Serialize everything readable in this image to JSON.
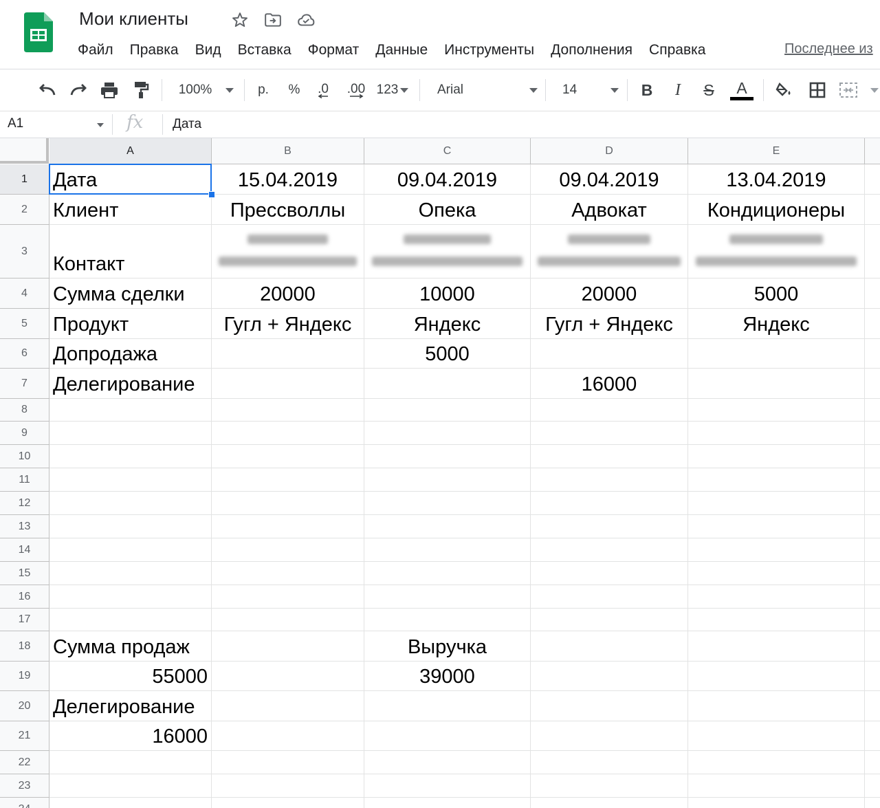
{
  "document": {
    "title": "Мои клиенты"
  },
  "menu": [
    "Файл",
    "Правка",
    "Вид",
    "Вставка",
    "Формат",
    "Данные",
    "Инструменты",
    "Дополнения",
    "Справка"
  ],
  "last_edit_label": "Последнее из",
  "toolbar": {
    "zoom": "100%",
    "currency": "р.",
    "percent": "%",
    "decrease_decimals": ".0",
    "increase_decimals": ".00",
    "number_format": "123",
    "font": "Arial",
    "font_size": "14",
    "bold": "B",
    "italic": "I",
    "strikethrough": "S",
    "text_color": "A"
  },
  "formula_bar": {
    "cell_ref": "A1",
    "fx_label": "fx",
    "content": "Дата"
  },
  "columns": [
    "A",
    "B",
    "C",
    "D",
    "E"
  ],
  "row_numbers": [
    "1",
    "2",
    "3",
    "4",
    "5",
    "6",
    "7",
    "8",
    "9",
    "10",
    "11",
    "12",
    "13",
    "14",
    "15",
    "16",
    "17",
    "18",
    "19",
    "20",
    "21",
    "22",
    "23",
    "24"
  ],
  "rows": [
    [
      "Дата",
      "15.04.2019",
      "09.04.2019",
      "09.04.2019",
      "13.04.2019"
    ],
    [
      "Клиент",
      "Прессволлы",
      "Опека",
      "Адвокат",
      "Кондиционеры"
    ],
    [
      "Контакт",
      "",
      "",
      "",
      ""
    ],
    [
      "Сумма сделки",
      "20000",
      "10000",
      "20000",
      "5000"
    ],
    [
      "Продукт",
      "Гугл + Яндекс",
      "Яндекс",
      "Гугл + Яндекс",
      "Яндекс"
    ],
    [
      "Допродажа",
      "",
      "5000",
      "",
      ""
    ],
    [
      "Делегирование",
      "",
      "",
      "16000",
      ""
    ],
    [
      "",
      "",
      "",
      "",
      ""
    ],
    [
      "",
      "",
      "",
      "",
      ""
    ],
    [
      "",
      "",
      "",
      "",
      ""
    ],
    [
      "",
      "",
      "",
      "",
      ""
    ],
    [
      "",
      "",
      "",
      "",
      ""
    ],
    [
      "",
      "",
      "",
      "",
      ""
    ],
    [
      "",
      "",
      "",
      "",
      ""
    ],
    [
      "",
      "",
      "",
      "",
      ""
    ],
    [
      "",
      "",
      "",
      "",
      ""
    ],
    [
      "",
      "",
      "",
      "",
      ""
    ],
    [
      "Сумма продаж",
      "",
      "Выручка",
      "",
      ""
    ],
    [
      "55000",
      "",
      "39000",
      "",
      ""
    ],
    [
      "Делегирование",
      "",
      "",
      "",
      ""
    ],
    [
      "16000",
      "",
      "",
      "",
      ""
    ],
    [
      "",
      "",
      "",
      "",
      ""
    ],
    [
      "",
      "",
      "",
      "",
      ""
    ],
    [
      "",
      "",
      "",
      "",
      ""
    ]
  ],
  "redacted_cells": [
    "B3",
    "C3",
    "D3",
    "E3"
  ],
  "selected_cell": "A1",
  "colors": {
    "accent": "#1a73e8",
    "sheets_green": "#0f9d58"
  }
}
